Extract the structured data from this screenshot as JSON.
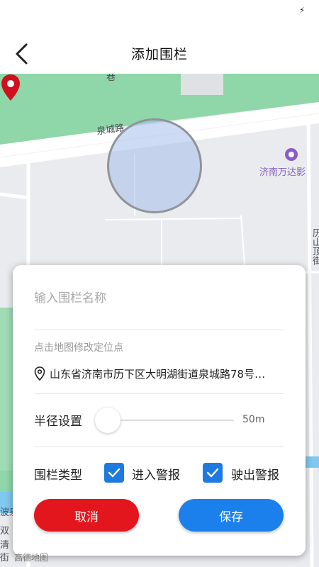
{
  "status": {
    "icon": "bolt-icon",
    "glyph": "⚡"
  },
  "header": {
    "title": "添加围栏",
    "back_icon": "chevron-left-icon"
  },
  "map": {
    "labels": {
      "road_top": "巷",
      "road_main": "泉城路",
      "poi": "济南万达影",
      "right_vertical": "历山顶街",
      "left_fragment_1": "波泉",
      "left_fragment_2": "双",
      "left_fragment_3": "清",
      "left_fragment_4": "街"
    },
    "attribution": "高德地图"
  },
  "form": {
    "name_placeholder": "输入围栏名称",
    "name_value": "",
    "location_hint": "点击地图修改定位点",
    "address": "山东省济南市历下区大明湖街道泉城路78号…",
    "radius_label": "半径设置",
    "radius_value": "50m",
    "radius_level": 0,
    "fence_type_label": "围栏类型",
    "enter_alarm": {
      "label": "进入警报",
      "checked": true
    },
    "exit_alarm": {
      "label": "驶出警报",
      "checked": true
    }
  },
  "actions": {
    "cancel_label": "取消",
    "save_label": "保存"
  },
  "colors": {
    "cancel": "#e4161d",
    "save": "#1c80ec",
    "checkbox": "#1f7ae0",
    "pin": "#d0101c",
    "green_area": "#8fd6a9"
  }
}
